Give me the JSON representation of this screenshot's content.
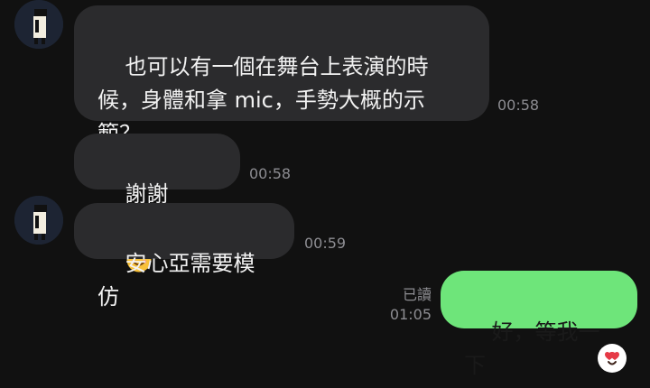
{
  "messages": [
    {
      "text": "也可以有一個在舞台上表演的時\n候，身體和拿 mic，手勢大概的示\n範？",
      "time": "00:58"
    },
    {
      "text": "謝謝",
      "time": "00:58"
    },
    {
      "text": "安心亞需要模仿",
      "time": "00:59"
    },
    {
      "text": "好，等我一下",
      "read": "已讀",
      "time": "01:05"
    }
  ],
  "colors": {
    "background": "#111111",
    "incoming_bubble": "#2b2b2d",
    "outgoing_bubble": "#6ee57a",
    "timestamp": "#8d8d92"
  },
  "icons": {
    "avatar": "contact-avatar",
    "emoji_1": "folded-hands-emoji",
    "emoji_2": "smiling-face-emoji",
    "reaction": "heart-eyes-reaction-icon"
  }
}
